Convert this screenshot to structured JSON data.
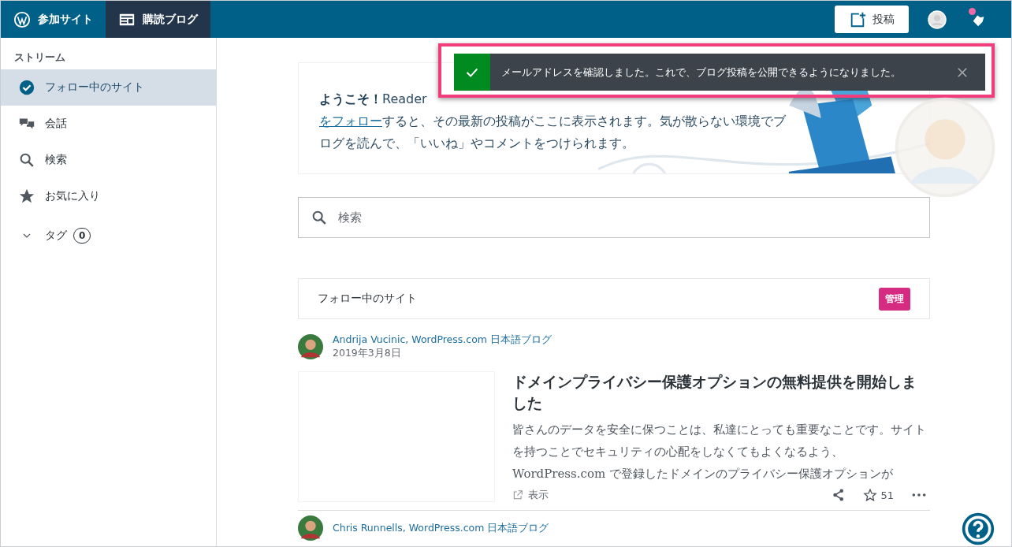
{
  "masterbar": {
    "tabs": [
      {
        "kind": "sites",
        "label": "参加サイト",
        "selected": false
      },
      {
        "kind": "reader",
        "label": "購読ブログ",
        "selected": true
      }
    ],
    "post_button": "投稿",
    "notifications_unread": true
  },
  "sidebar": {
    "heading": "ストリーム",
    "items": [
      {
        "kind": "check",
        "label": "フォロー中のサイト",
        "selected": true
      },
      {
        "kind": "chat",
        "label": "会話",
        "selected": false
      },
      {
        "kind": "search",
        "label": "検索",
        "selected": false
      },
      {
        "kind": "star",
        "label": "お気に入り",
        "selected": false
      }
    ],
    "tags": {
      "label": "タグ",
      "count": "0",
      "expanded": false
    }
  },
  "notice": {
    "message": "メールアドレスを確認しました。これで、ブログ投稿を公開できるようになりました。",
    "highlighted": true
  },
  "welcome": {
    "lead": "**ようこそ！**Reader",
    "link": "をフォロー",
    "text": "すると、その最新の投稿がここに表示されます。気が散らない環境でブログを読んで、「いいね」やコメントをつけられます。"
  },
  "search": {
    "placeholder": "検索"
  },
  "following": {
    "title": "フォロー中のサイト",
    "manage": "管理"
  },
  "posts": [
    {
      "author": "Andrija Vucinic, WordPress.com 日本語ブログ",
      "date": "2019年3月8日",
      "title": "ドメインプライバシー保護オプションの無料提供を開始しました",
      "excerpt": "皆さんのデータを安全に保つことは、私達にとっても重要なことです。サイトを持つことでセキュリティの心配をしなくてもよくなるよう、WordPress.com で登録したドメインのプライバシー保護オプションが",
      "visit": "表示",
      "likes": "51"
    },
    {
      "author": "Chris Runnells, WordPress.com 日本語ブログ"
    }
  ]
}
